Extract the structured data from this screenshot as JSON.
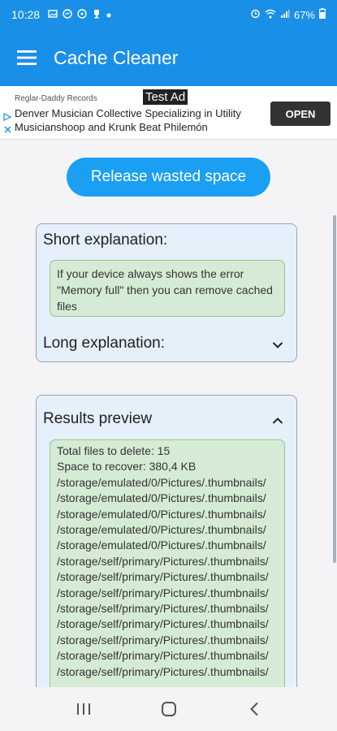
{
  "status_bar": {
    "time": "10:28",
    "battery": "67%",
    "icons_left": [
      "image-icon",
      "messenger-icon",
      "whatsapp-icon",
      "trophy-icon",
      "dot-icon"
    ],
    "icons_right": [
      "alarm-icon",
      "wifi-icon",
      "signal-icon",
      "battery-icon"
    ]
  },
  "app_bar": {
    "title": "Cache Cleaner"
  },
  "ad": {
    "badge": "Test Ad",
    "source": "Reglar-Daddy Records",
    "text": "Denver Musician Collective Specializing in Utility Musicianshoop and Krunk Beat Philemón",
    "button": "OPEN"
  },
  "main": {
    "release_button": "Release wasted space",
    "short_heading": "Short explanation:",
    "short_text": "If your device always shows the error \"Memory full\" then you can remove cached files",
    "long_heading": "Long explanation:",
    "results_heading": "Results preview",
    "results_lines": [
      "Total files to delete: 15",
      "Space to recover: 380,4 KB",
      "/storage/emulated/0/Pictures/.thumbnails/",
      "/storage/emulated/0/Pictures/.thumbnails/",
      "/storage/emulated/0/Pictures/.thumbnails/",
      "/storage/emulated/0/Pictures/.thumbnails/",
      "/storage/emulated/0/Pictures/.thumbnails/",
      "/storage/self/primary/Pictures/.thumbnails/",
      "/storage/self/primary/Pictures/.thumbnails/",
      "/storage/self/primary/Pictures/.thumbnails/",
      "/storage/self/primary/Pictures/.thumbnails/",
      "/storage/self/primary/Pictures/.thumbnails/",
      "/storage/self/primary/Pictures/.thumbnails/",
      "/storage/self/primary/Pictures/.thumbnails/",
      "/storage/self/primary/Pictures/.thumbnails/"
    ]
  },
  "colors": {
    "primary": "#1a8fe8",
    "button": "#1a9ff2",
    "card_bg": "#e6f0fb",
    "green_box": "#d6ebd6"
  }
}
